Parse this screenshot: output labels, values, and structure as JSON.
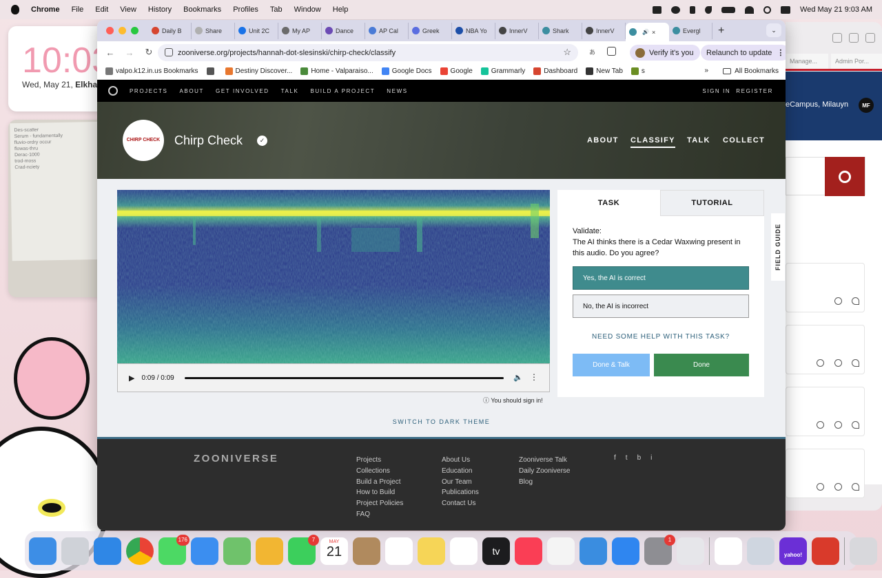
{
  "menubar": {
    "app": "Chrome",
    "items": [
      "File",
      "Edit",
      "View",
      "History",
      "Bookmarks",
      "Profiles",
      "Tab",
      "Window",
      "Help"
    ],
    "clock": "Wed May 21  9:03 AM"
  },
  "widgets": {
    "clock_time": "10:03",
    "clock_date": "Wed, May 21,",
    "clock_extra": "Elkha",
    "note_lines": [
      "Des-scatter",
      "Serum - fundamentally",
      "fluvio-ordry occur",
      "flowas-thru",
      "Derac-1000",
      "trod-moss",
      "Crad-nciety"
    ]
  },
  "browser": {
    "tabs": [
      {
        "label": "Daily B",
        "color": "#d6452f"
      },
      {
        "label": "Share",
        "color": "#b0b0b0"
      },
      {
        "label": "Unit 2C",
        "color": "#1a73e8"
      },
      {
        "label": "My AP",
        "color": "#6b6b6b"
      },
      {
        "label": "Dance",
        "color": "#6c4bb4"
      },
      {
        "label": "AP Cal",
        "color": "#4a7bd6"
      },
      {
        "label": "Greek",
        "color": "#5a6de0"
      },
      {
        "label": "NBA Yo",
        "color": "#1d4fa8"
      },
      {
        "label": "InnerV",
        "color": "#444"
      },
      {
        "label": "Shark",
        "color": "#3c8ea0"
      },
      {
        "label": "InnerV",
        "color": "#444"
      },
      {
        "label": "",
        "color": "#3c8ea0"
      },
      {
        "label": "Evergl",
        "color": "#3c8ea0"
      }
    ],
    "tab_close": "×",
    "url": "zooniverse.org/projects/hannah-dot-slesinski/chirp-check/classify",
    "verify": "Verify it's you",
    "relaunch": "Relaunch to update",
    "bookmarks": [
      {
        "label": "valpo.k12.in.us Bookmarks",
        "color": "#777"
      },
      {
        "label": "",
        "color": "#555"
      },
      {
        "label": "Destiny Discover...",
        "color": "#e8772e"
      },
      {
        "label": "Home - Valparaiso...",
        "color": "#4a8a3a"
      },
      {
        "label": "Google Docs",
        "color": "#4285f4"
      },
      {
        "label": "Google",
        "color": "#ea4335"
      },
      {
        "label": "Grammarly",
        "color": "#15c39a"
      },
      {
        "label": "Dashboard",
        "color": "#d6452f"
      },
      {
        "label": "New Tab",
        "color": "#333"
      },
      {
        "label": "s",
        "color": "#6b8e23"
      }
    ],
    "all_bookmarks": "All Bookmarks"
  },
  "site": {
    "nav": [
      "PROJECTS",
      "ABOUT",
      "GET INVOLVED",
      "TALK",
      "BUILD A PROJECT",
      "NEWS"
    ],
    "signin": "SIGN IN",
    "register": "REGISTER",
    "project_title": "Chirp Check",
    "logo_text": "CHIRP CHECK",
    "project_nav": [
      "ABOUT",
      "CLASSIFY",
      "TALK",
      "COLLECT"
    ],
    "active_nav": "CLASSIFY"
  },
  "player": {
    "time": "0:09 / 0:09",
    "progress": 1.0
  },
  "signin_notice": "You should sign in!",
  "task": {
    "tab_task": "TASK",
    "tab_tutorial": "TUTORIAL",
    "question_label": "Validate:",
    "question_text": "The AI thinks there is a Cedar Waxwing present in this audio. Do you agree?",
    "options": [
      "Yes, the AI is correct",
      "No, the AI is incorrect"
    ],
    "help": "NEED SOME HELP WITH THIS TASK?",
    "done_talk": "Done & Talk",
    "done": "Done"
  },
  "field_guide": "FIELD GUIDE",
  "dark_theme": "SWITCH TO DARK THEME",
  "footer": {
    "logo": "ZOONIVERSE",
    "col1": [
      "Projects",
      "Collections",
      "Build a Project",
      "How to Build",
      "Project Policies",
      "FAQ"
    ],
    "col2": [
      "About Us",
      "Education",
      "Our Team",
      "Publications",
      "Contact Us"
    ],
    "col3": [
      "Zooniverse Talk",
      "Daily Zooniverse",
      "Blog"
    ],
    "social": [
      "f",
      "t",
      "b",
      "i"
    ]
  },
  "bg_window": {
    "tab1": "Manage...",
    "tab2": "Admin Por...",
    "header_text": "eCampus, Milauyn",
    "avatar": "MF"
  },
  "dock": {
    "apps": [
      {
        "name": "finder",
        "color": "#3d8ee6"
      },
      {
        "name": "launchpad",
        "color": "#cfd2d8"
      },
      {
        "name": "safari",
        "color": "#2f87e6"
      },
      {
        "name": "chrome",
        "color": "#e94b3c"
      },
      {
        "name": "messages",
        "color": "#4cd964",
        "badge": "176"
      },
      {
        "name": "mail",
        "color": "#3b8ef0"
      },
      {
        "name": "maps",
        "color": "#6fc26b"
      },
      {
        "name": "photos",
        "color": "#f2b632"
      },
      {
        "name": "facetime",
        "color": "#3ccf5c",
        "badge": "7"
      },
      {
        "name": "calendar",
        "color": "#ffffff"
      },
      {
        "name": "contacts",
        "color": "#b08a5e"
      },
      {
        "name": "reminders",
        "color": "#ffffff"
      },
      {
        "name": "notes",
        "color": "#f6d557"
      },
      {
        "name": "freeform",
        "color": "#ffffff"
      },
      {
        "name": "tv",
        "color": "#1c1c1e"
      },
      {
        "name": "music",
        "color": "#fa3e55"
      },
      {
        "name": "news",
        "color": "#f4f4f4"
      },
      {
        "name": "keynote",
        "color": "#3a8de0"
      },
      {
        "name": "appstore",
        "color": "#2f86f0"
      },
      {
        "name": "settings",
        "color": "#8e8e93",
        "badge": "1"
      },
      {
        "name": "iphone-mirroring",
        "color": "#e6e6ea"
      },
      {
        "name": "netflix",
        "color": "#ffffff"
      },
      {
        "name": "preview",
        "color": "#cfd6e0"
      },
      {
        "name": "yahoo",
        "color": "#6b2fd6"
      },
      {
        "name": "photobooth",
        "color": "#d93a2b"
      },
      {
        "name": "trash",
        "color": "#d8d8dc"
      }
    ],
    "calendar_month": "MAY",
    "calendar_day": "21",
    "tv_label": "tv",
    "yahoo_label": "yahoo!"
  }
}
